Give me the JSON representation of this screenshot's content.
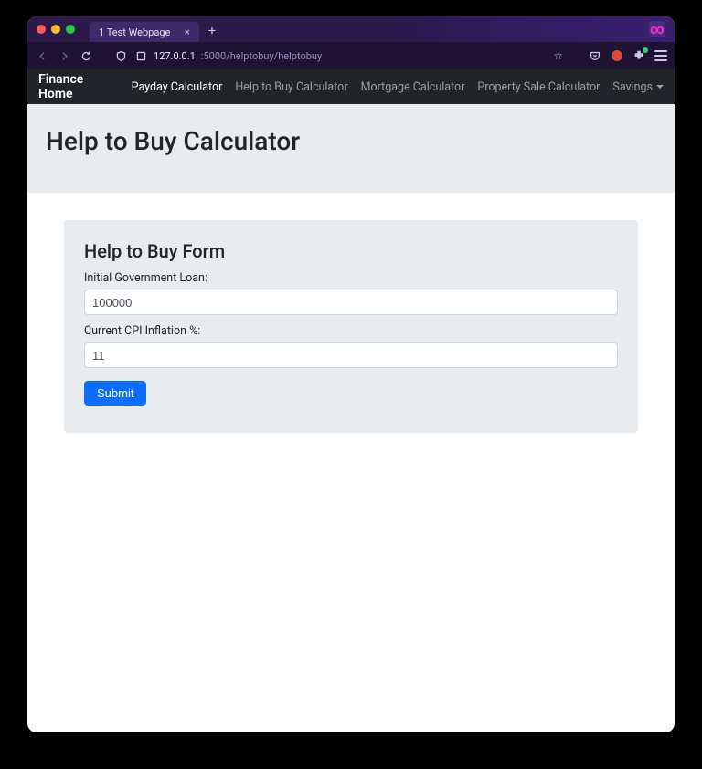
{
  "browser": {
    "tab_title": "1 Test Webpage",
    "url_host": "127.0.0.1",
    "url_port_path": ":5000/helptobuy/helptobuy"
  },
  "nav": {
    "brand": "Finance Home",
    "links": [
      {
        "label": "Payday Calculator",
        "active": true
      },
      {
        "label": "Help to Buy Calculator",
        "active": false
      },
      {
        "label": "Mortgage Calculator",
        "active": false
      },
      {
        "label": "Property Sale Calculator",
        "active": false
      }
    ],
    "dropdown_label": "Savings"
  },
  "hero": {
    "title": "Help to Buy Calculator"
  },
  "form": {
    "heading": "Help to Buy Form",
    "fields": {
      "loan_label": "Initial Government Loan:",
      "loan_value": "100000",
      "cpi_label": "Current CPI Inflation %:",
      "cpi_value": "11"
    },
    "submit_label": "Submit"
  }
}
